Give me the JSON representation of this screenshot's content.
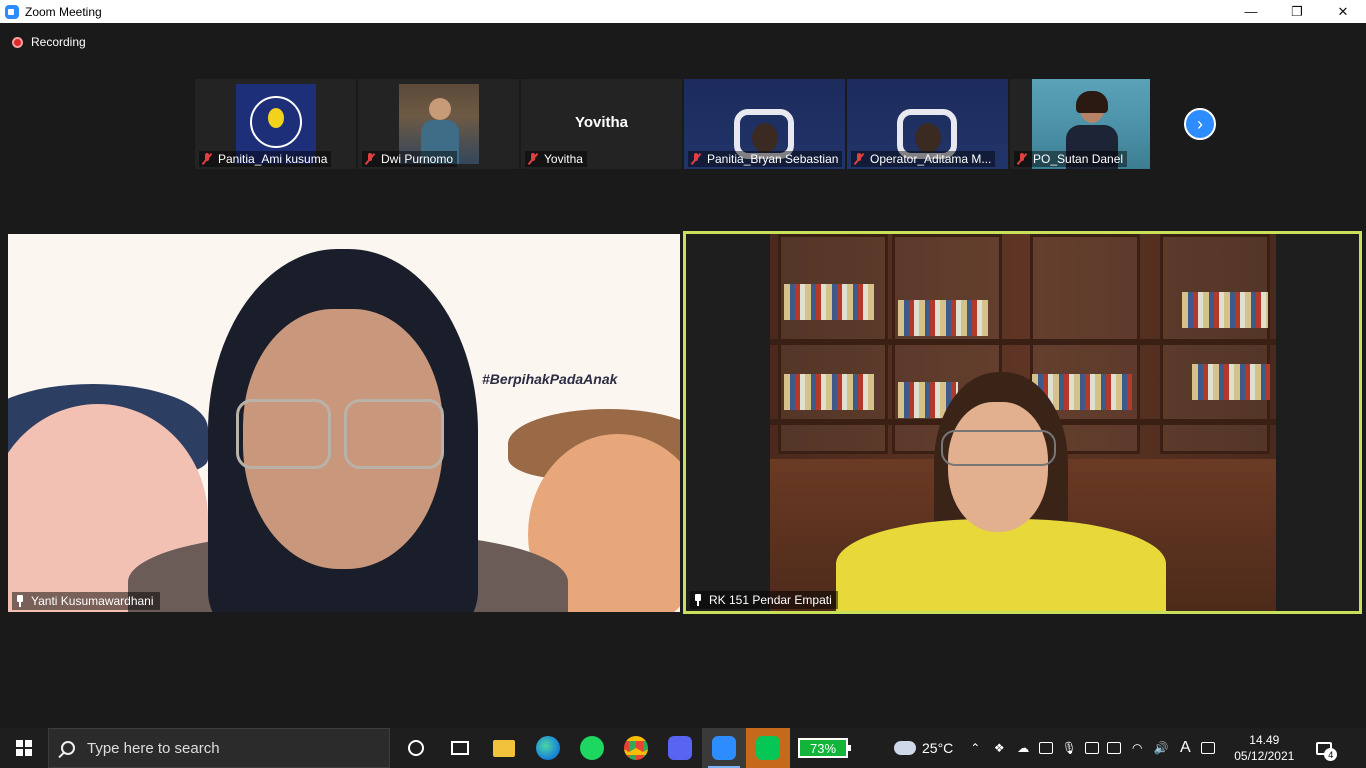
{
  "window": {
    "title": "Zoom Meeting",
    "minimize_icon": "—",
    "restore_icon": "❐",
    "close_icon": "✕"
  },
  "recording": {
    "label": "Recording"
  },
  "thumbnails": [
    {
      "name": "Panitia_Ami kusuma",
      "muted": true
    },
    {
      "name": "Dwi Purnomo",
      "muted": true
    },
    {
      "name": "Yovitha",
      "display_text": "Yovitha",
      "muted": true
    },
    {
      "name": "Panitia_Bryan Sebastian",
      "muted": true
    },
    {
      "name": "Operator_Aditama M...",
      "muted": true
    },
    {
      "name": "PO_Sutan Danel",
      "muted": true
    }
  ],
  "thumbnail_next": {
    "icon": "chevron-right-icon",
    "glyph": "›"
  },
  "main_videos": {
    "left": {
      "name": "Yanti Kusumawardhani",
      "hashtag": "#BerpihakPadaAnak"
    },
    "right": {
      "name": "RK 151 Pendar Empati",
      "active_speaker_color": "#c8e05a"
    }
  },
  "taskbar": {
    "search_placeholder": "Type here to search",
    "battery_percent": "73%",
    "temperature": "25°C",
    "time": "14.49",
    "date": "05/12/2021",
    "notification_count": "4",
    "ime_label": "A"
  }
}
